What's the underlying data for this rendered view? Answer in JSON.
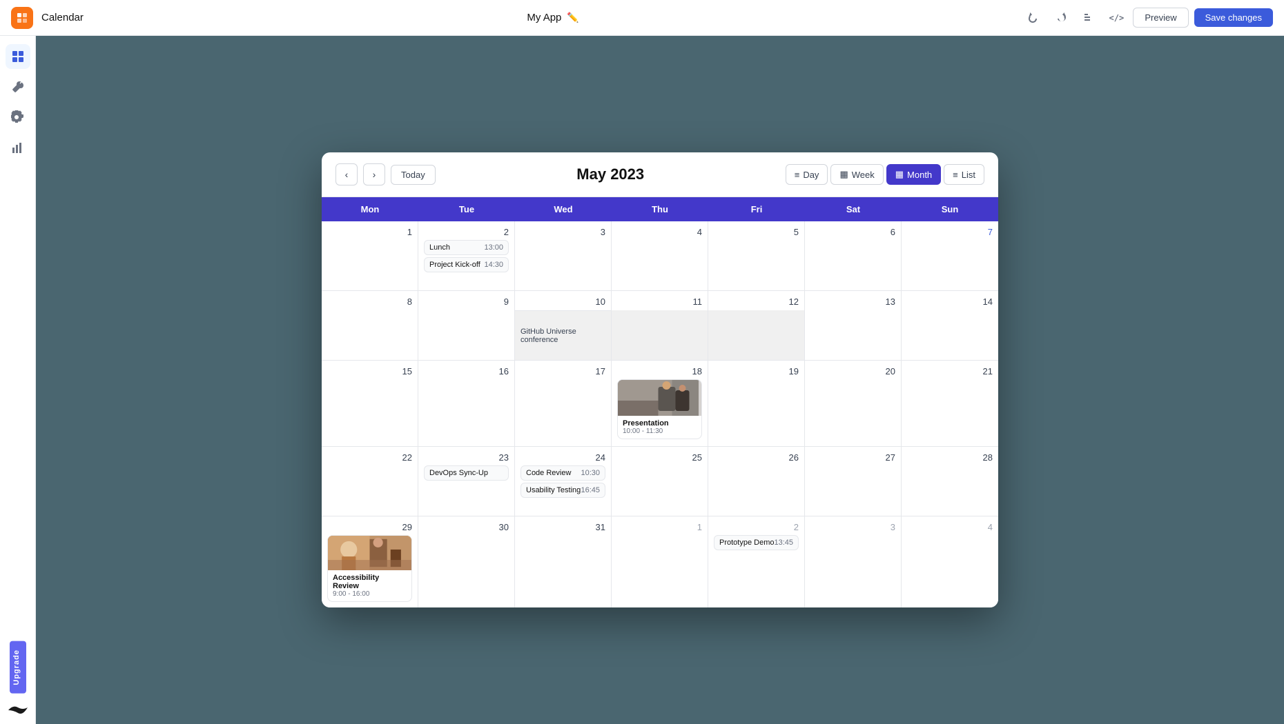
{
  "topbar": {
    "logo_icon": "⬛",
    "title": "Calendar",
    "app_name": "My App",
    "edit_icon": "✏️",
    "undo_icon": "↩",
    "redo_icon": "↪",
    "bucket_icon": "🪣",
    "code_icon": "</>",
    "preview_label": "Preview",
    "save_label": "Save changes"
  },
  "sidebar": {
    "items": [
      {
        "name": "dashboard",
        "icon": "▦"
      },
      {
        "name": "tools",
        "icon": "🔧"
      },
      {
        "name": "settings",
        "icon": "⚙"
      },
      {
        "name": "analytics",
        "icon": "📊"
      }
    ],
    "upgrade_label": "Upgrade"
  },
  "calendar": {
    "title": "May 2023",
    "nav": {
      "prev_label": "‹",
      "next_label": "›",
      "today_label": "Today"
    },
    "views": [
      {
        "id": "day",
        "label": "Day",
        "icon": "≡"
      },
      {
        "id": "week",
        "label": "Week",
        "icon": "▦"
      },
      {
        "id": "month",
        "label": "Month",
        "icon": "▦",
        "active": true
      },
      {
        "id": "list",
        "label": "List",
        "icon": "≡"
      }
    ],
    "day_headers": [
      "Mon",
      "Tue",
      "Wed",
      "Thu",
      "Fri",
      "Sat",
      "Sun"
    ],
    "weeks": [
      {
        "days": [
          {
            "num": "1",
            "other": false
          },
          {
            "num": "2",
            "other": false,
            "events": [
              {
                "type": "simple",
                "name": "Lunch",
                "time": "13:00"
              },
              {
                "type": "simple",
                "name": "Project Kick-off",
                "time": "14:30"
              }
            ]
          },
          {
            "num": "3",
            "other": false
          },
          {
            "num": "4",
            "other": false
          },
          {
            "num": "5",
            "other": false
          },
          {
            "num": "6",
            "other": false
          },
          {
            "num": "7",
            "other": false,
            "sunday": true
          }
        ]
      },
      {
        "days": [
          {
            "num": "8",
            "other": false
          },
          {
            "num": "9",
            "other": false
          },
          {
            "num": "10",
            "other": false,
            "spanEvent": "GitHub Universe conference"
          },
          {
            "num": "11",
            "other": false,
            "spanContinue": true
          },
          {
            "num": "12",
            "other": false,
            "spanContinue": true
          },
          {
            "num": "13",
            "other": false
          },
          {
            "num": "14",
            "other": false
          }
        ]
      },
      {
        "days": [
          {
            "num": "15",
            "other": false
          },
          {
            "num": "16",
            "other": false
          },
          {
            "num": "17",
            "other": false
          },
          {
            "num": "18",
            "other": false,
            "events": [
              {
                "type": "presentation",
                "name": "Presentation",
                "time": "10:00 - 11:30"
              }
            ]
          },
          {
            "num": "19",
            "other": false
          },
          {
            "num": "20",
            "other": false
          },
          {
            "num": "21",
            "other": false
          }
        ]
      },
      {
        "days": [
          {
            "num": "22",
            "other": false
          },
          {
            "num": "23",
            "other": false,
            "events": [
              {
                "type": "simple",
                "name": "DevOps Sync-Up",
                "time": ""
              }
            ]
          },
          {
            "num": "24",
            "other": false,
            "events": [
              {
                "type": "simple",
                "name": "Code Review",
                "time": "10:30"
              },
              {
                "type": "simple",
                "name": "Usability Testing",
                "time": "16:45"
              }
            ]
          },
          {
            "num": "25",
            "other": false
          },
          {
            "num": "26",
            "other": false
          },
          {
            "num": "27",
            "other": false
          },
          {
            "num": "28",
            "other": false
          }
        ]
      },
      {
        "days": [
          {
            "num": "29",
            "other": false,
            "events": [
              {
                "type": "accessibility",
                "name": "Accessibility Review",
                "time": "9:00 - 16:00"
              }
            ]
          },
          {
            "num": "30",
            "other": false
          },
          {
            "num": "31",
            "other": false
          },
          {
            "num": "1",
            "other": true
          },
          {
            "num": "2",
            "other": true,
            "events": [
              {
                "type": "prototype",
                "name": "Prototype Demo",
                "time": "13:45"
              }
            ]
          },
          {
            "num": "3",
            "other": true
          },
          {
            "num": "4",
            "other": true
          }
        ]
      }
    ]
  }
}
